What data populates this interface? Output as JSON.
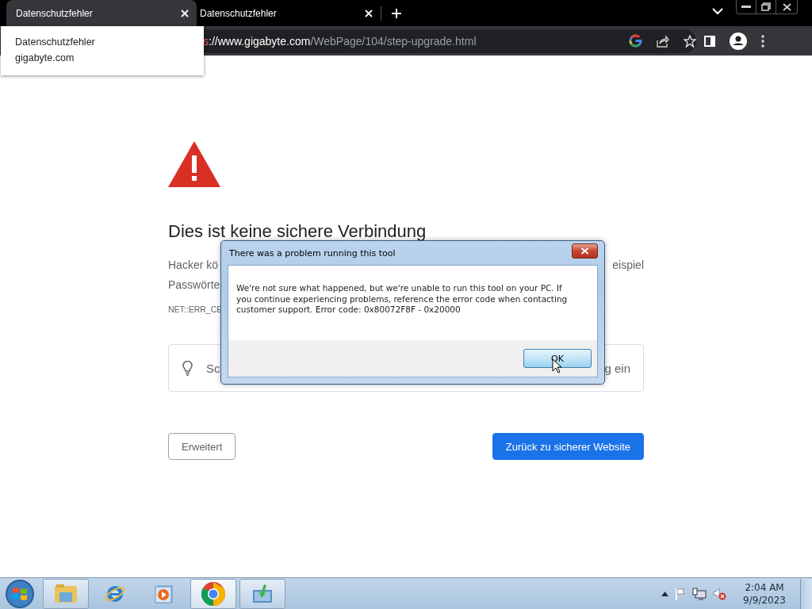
{
  "browser": {
    "tabs": [
      {
        "title": "Datenschutzfehler",
        "selected": true
      },
      {
        "title": "Datenschutzfehler",
        "selected": false
      }
    ],
    "tab_tooltip": {
      "title": "Datenschutzfehler",
      "domain": "gigabyte.com"
    },
    "address_bar": {
      "scheme_fragment": "s",
      "host": "://www.gigabyte.com",
      "path": "/WebPage/104/step-upgrade.html"
    }
  },
  "page": {
    "heading": "Dies ist keine sichere Verbindung",
    "paragraph_lines": [
      {
        "left": "Hacker kö",
        "right": "eispiel"
      },
      {
        "left": "Passwörte"
      }
    ],
    "error_code": "NET::ERR_CE",
    "suggestion": {
      "left": "Sc",
      "right": "g ein"
    },
    "buttons": [
      {
        "label": "Erweitert",
        "kind": "secondary"
      },
      {
        "label": "Zurück zu sicherer Website",
        "kind": "primary"
      }
    ]
  },
  "dialog": {
    "title": "There was a problem running this tool",
    "message": "We're not sure what happened, but we're unable to run this tool on your PC. If you continue experiencing problems, reference the error code when contacting customer support. Error code: 0x80072F8F - 0x20000",
    "buttons": [
      "OK"
    ]
  },
  "taskbar": {
    "apps": [
      {
        "kind": "explorer",
        "running": true,
        "active": false
      },
      {
        "kind": "ie",
        "running": false,
        "active": false
      },
      {
        "kind": "media",
        "running": false,
        "active": false
      },
      {
        "kind": "chrome",
        "running": true,
        "active": true
      },
      {
        "kind": "installer",
        "running": true,
        "active": false
      }
    ],
    "clock": {
      "time": "2:04 AM",
      "date": "9/9/2023"
    }
  }
}
